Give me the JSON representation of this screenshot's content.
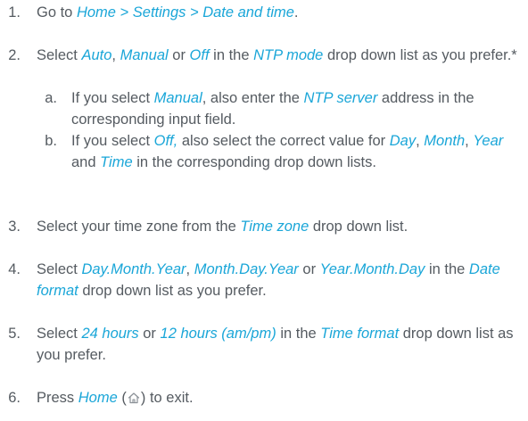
{
  "steps": [
    {
      "num": "1.",
      "parts": [
        {
          "t": "Go to ",
          "hl": false
        },
        {
          "t": "Home > Settings > Date and time",
          "hl": true
        },
        {
          "t": ".",
          "hl": false
        }
      ]
    },
    {
      "num": "2.",
      "parts": [
        {
          "t": "Select ",
          "hl": false
        },
        {
          "t": "Auto",
          "hl": true
        },
        {
          "t": ", ",
          "hl": false
        },
        {
          "t": "Manual",
          "hl": true
        },
        {
          "t": " or ",
          "hl": false
        },
        {
          "t": "Off",
          "hl": true
        },
        {
          "t": " in the ",
          "hl": false
        },
        {
          "t": "NTP mode",
          "hl": true
        },
        {
          "t": " drop down list as you prefer.*",
          "hl": false
        }
      ],
      "subs": [
        {
          "num": "a.",
          "parts": [
            {
              "t": "If you select ",
              "hl": false
            },
            {
              "t": "Manual",
              "hl": true
            },
            {
              "t": ", also enter the ",
              "hl": false
            },
            {
              "t": "NTP server",
              "hl": true
            },
            {
              "t": " address in the corresponding input field.",
              "hl": false
            }
          ]
        },
        {
          "num": "b.",
          "parts": [
            {
              "t": "If you select ",
              "hl": false
            },
            {
              "t": "Off,",
              "hl": true
            },
            {
              "t": " also select the correct value for ",
              "hl": false
            },
            {
              "t": "Day",
              "hl": true
            },
            {
              "t": ", ",
              "hl": false
            },
            {
              "t": "Month",
              "hl": true
            },
            {
              "t": ", ",
              "hl": false
            },
            {
              "t": "Year",
              "hl": true
            },
            {
              "t": " and ",
              "hl": false
            },
            {
              "t": "Time",
              "hl": true
            },
            {
              "t": " in the corresponding drop down lists.",
              "hl": false
            }
          ]
        }
      ]
    },
    {
      "num": "3.",
      "parts": [
        {
          "t": "Select your time zone from the ",
          "hl": false
        },
        {
          "t": "Time zone",
          "hl": true
        },
        {
          "t": " drop down list.",
          "hl": false
        }
      ]
    },
    {
      "num": "4.",
      "parts": [
        {
          "t": "Select ",
          "hl": false
        },
        {
          "t": "Day.Month.Year",
          "hl": true
        },
        {
          "t": ", ",
          "hl": false
        },
        {
          "t": "Month.Day.Year",
          "hl": true
        },
        {
          "t": " or ",
          "hl": false
        },
        {
          "t": "Year.Month.Day",
          "hl": true
        },
        {
          "t": " in the ",
          "hl": false
        },
        {
          "t": "Date format",
          "hl": true
        },
        {
          "t": " drop down list as you prefer.",
          "hl": false
        }
      ]
    },
    {
      "num": "5.",
      "parts": [
        {
          "t": "Select ",
          "hl": false
        },
        {
          "t": "24 hours",
          "hl": true
        },
        {
          "t": " or ",
          "hl": false
        },
        {
          "t": "12 hours (am/pm)",
          "hl": true
        },
        {
          "t": " in the ",
          "hl": false
        },
        {
          "t": "Time format",
          "hl": true
        },
        {
          "t": " drop down list as you prefer.",
          "hl": false
        }
      ]
    },
    {
      "num": "6.",
      "parts": [
        {
          "t": "Press ",
          "hl": false
        },
        {
          "t": "Home",
          "hl": true
        },
        {
          "t": " (",
          "hl": false
        },
        {
          "icon": "home-icon"
        },
        {
          "t": ") to exit.",
          "hl": false
        }
      ]
    }
  ],
  "colors": {
    "text": "#555b61",
    "highlight": "#1aa6d8",
    "icon_stroke": "#8a9096"
  }
}
